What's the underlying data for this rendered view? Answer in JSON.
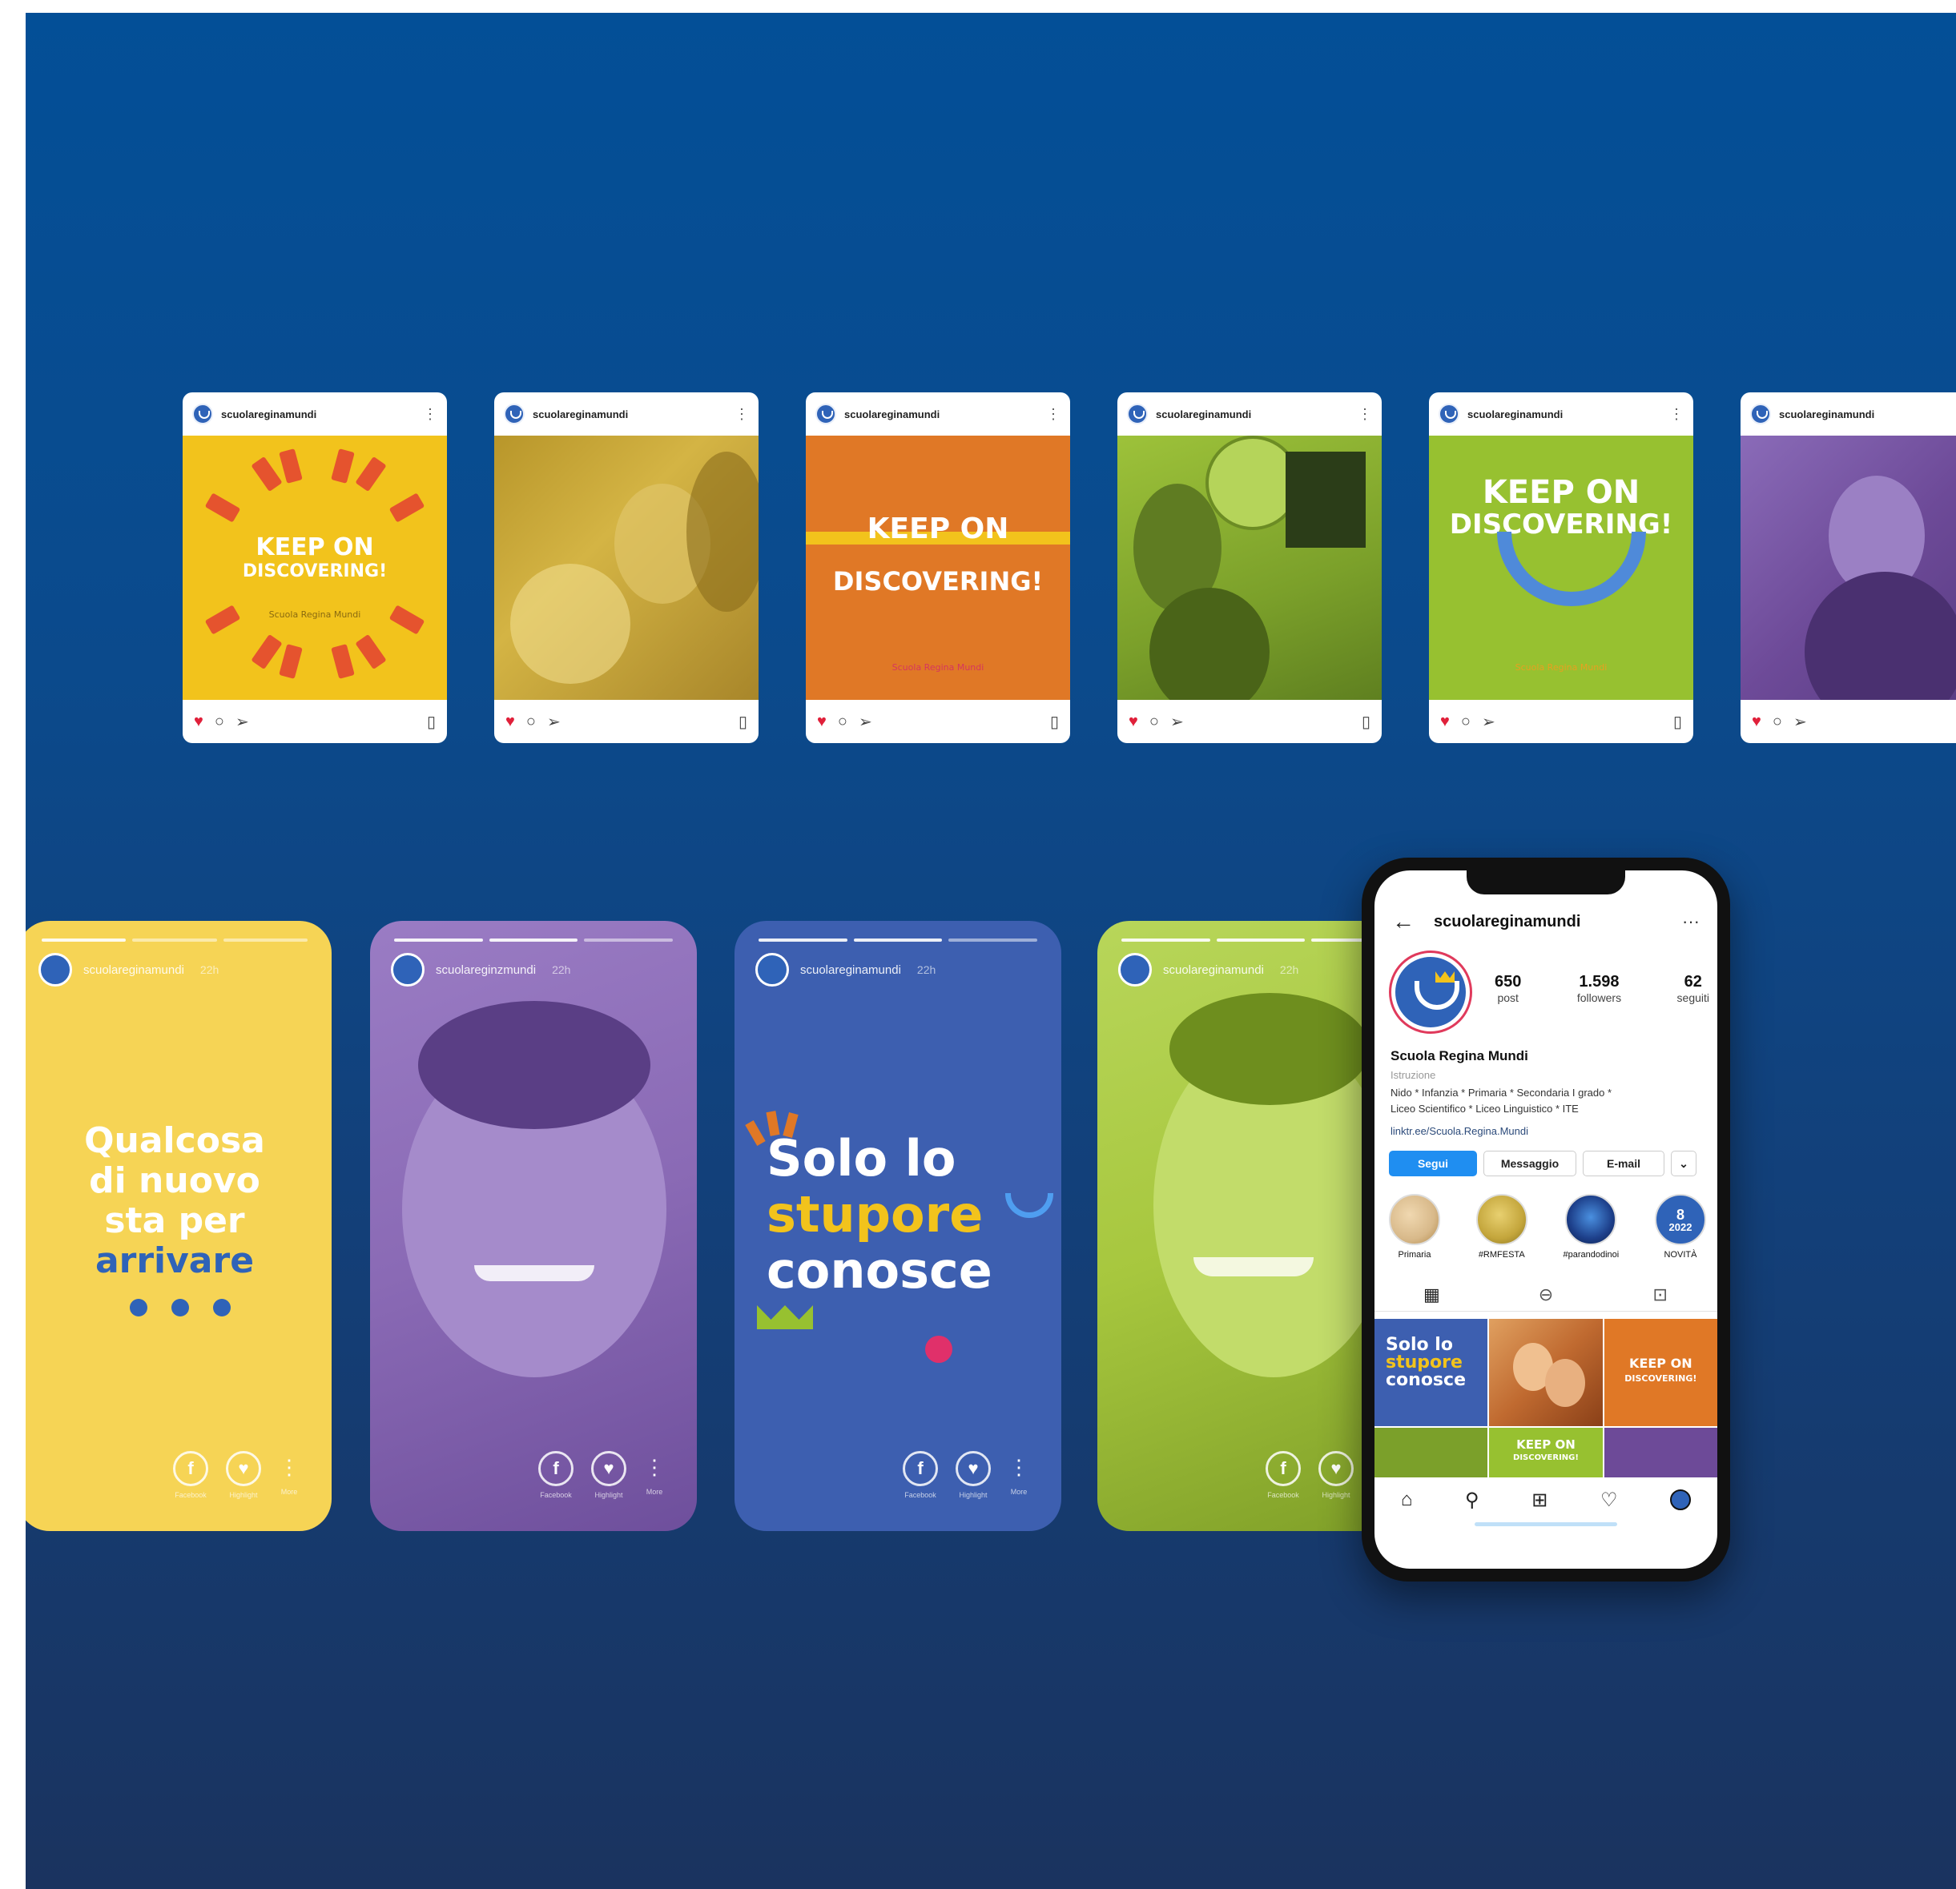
{
  "account": {
    "handle": "scuolareginamundi",
    "handle_story_alt": "scuolareginzmundi",
    "story_time": "22h"
  },
  "posts": [
    {
      "id": "post-1",
      "user": "scuolareginamundi",
      "line1": "KEEP ON",
      "line2": "DISCOVERING!",
      "caption": "Scuola Regina Mundi",
      "bg": "#f2c31c"
    },
    {
      "id": "post-2",
      "user": "scuolareginamundi",
      "bg": "#c9a628"
    },
    {
      "id": "post-3",
      "user": "scuolareginamundi",
      "line1": "KEEP ON",
      "line2": "DISCOVERING!",
      "caption": "Scuola Regina Mundi",
      "bg": "#e07826"
    },
    {
      "id": "post-4",
      "user": "scuolareginamundi",
      "bg": "#8bb030"
    },
    {
      "id": "post-5",
      "user": "scuolareginamundi",
      "line1": "KEEP ON",
      "line2": "DISCOVERING!",
      "caption": "Scuola Regina Mundi",
      "bg": "#97c130"
    },
    {
      "id": "post-6",
      "user": "scuolareginamundi",
      "bg": "#6d4a98"
    }
  ],
  "stories": [
    {
      "user": "scuolareginamundi",
      "time": "22h",
      "text": [
        "Qualcosa",
        "di nuovo",
        "sta per",
        "arrivare"
      ],
      "bg": "#f6d455"
    },
    {
      "user": "scuolareginzmundi",
      "time": "22h",
      "bg": "#8a6ab5"
    },
    {
      "user": "scuolareginamundi",
      "time": "22h",
      "text": [
        "Solo lo",
        "stupore",
        "conosce"
      ],
      "bg": "#3d5fb0"
    },
    {
      "user": "scuolareginamundi",
      "time": "22h",
      "bg": "#a7c73e"
    }
  ],
  "story_actions": {
    "facebook": "Facebook",
    "highlight": "Highlight",
    "more": "More"
  },
  "profile": {
    "handle": "scuolareginamundi",
    "stats": [
      {
        "num": "650",
        "label": "post"
      },
      {
        "num": "1.598",
        "label": "followers"
      },
      {
        "num": "62",
        "label": "seguiti"
      }
    ],
    "name": "Scuola Regina Mundi",
    "category": "Istruzione",
    "bio_line1": "Nido * Infanzia * Primaria * Secondaria I grado *",
    "bio_line2": "Liceo Scientifico * Liceo Linguistico * ITE",
    "link": "linktr.ee/Scuola.Regina.Mundi",
    "buttons": {
      "follow": "Segui",
      "message": "Messaggio",
      "email": "E-mail"
    },
    "highlights": [
      {
        "label": "Primaria",
        "color": "#d8b98a"
      },
      {
        "label": "#RMFESTA",
        "color": "#c4a63c"
      },
      {
        "label": "#parandodinoi",
        "color": "#1d3f8a"
      },
      {
        "label": "NOVITÀ",
        "color": "#2f63b8",
        "date_num": "8",
        "date_year": "2022"
      }
    ],
    "grid_texts": {
      "solo_l1": "Solo lo",
      "solo_l2": "stupore",
      "solo_l3": "conosce",
      "keep_l1": "KEEP ON",
      "keep_l2": "DISCOVERING!"
    }
  },
  "colors": {
    "brand_blue": "#2f63b8",
    "heart_red": "#e0203a",
    "follow_blue": "#1f8ef1"
  }
}
